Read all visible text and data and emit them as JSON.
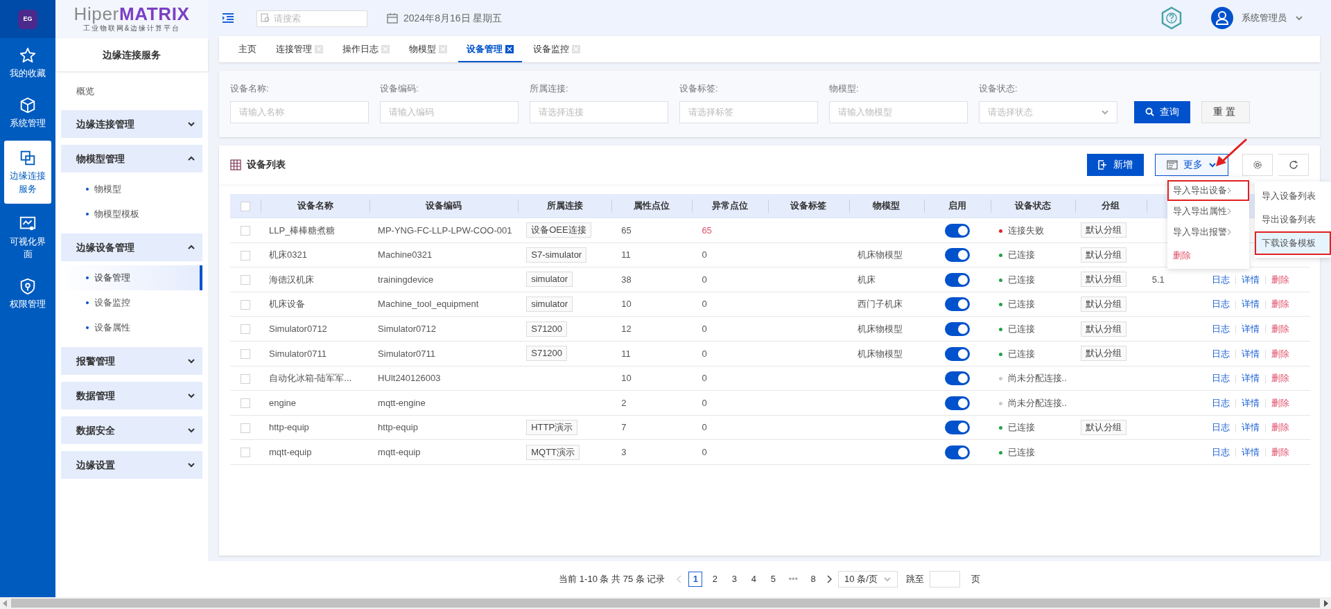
{
  "rail": {
    "app_icon_text": "EG",
    "items": [
      {
        "label": "我的收藏",
        "selected": false
      },
      {
        "label": "系统管理",
        "selected": false
      },
      {
        "label": "边缘连接服务",
        "selected": true
      },
      {
        "label": "可视化界面",
        "selected": false
      },
      {
        "label": "权限管理",
        "selected": false
      }
    ]
  },
  "sidebar": {
    "logo_prefix": "Hiper",
    "logo_suffix": "MATRIX",
    "logo_subtitle": "工业物联网&边缘计算平台",
    "title": "边缘连接服务",
    "items": [
      {
        "kind": "link",
        "label": "概览"
      },
      {
        "kind": "group",
        "label": "边缘连接管理",
        "expanded": false
      },
      {
        "kind": "group",
        "label": "物模型管理",
        "expanded": true,
        "children": [
          {
            "label": "物模型",
            "selected": false
          },
          {
            "label": "物模型模板",
            "selected": false
          }
        ]
      },
      {
        "kind": "group",
        "label": "边缘设备管理",
        "expanded": true,
        "children": [
          {
            "label": "设备管理",
            "selected": true
          },
          {
            "label": "设备监控",
            "selected": false
          },
          {
            "label": "设备属性",
            "selected": false
          }
        ]
      },
      {
        "kind": "group",
        "label": "报警管理",
        "expanded": false
      },
      {
        "kind": "group",
        "label": "数据管理",
        "expanded": false
      },
      {
        "kind": "group",
        "label": "数据安全",
        "expanded": false
      },
      {
        "kind": "group",
        "label": "边缘设置",
        "expanded": false
      }
    ]
  },
  "topbar": {
    "search_placeholder": "请搜索",
    "date": "2024年8月16日 星期五",
    "user": "系统管理员"
  },
  "tabs": [
    {
      "label": "主页",
      "closable": false,
      "selected": false
    },
    {
      "label": "连接管理",
      "closable": true,
      "selected": false
    },
    {
      "label": "操作日志",
      "closable": true,
      "selected": false
    },
    {
      "label": "物模型",
      "closable": true,
      "selected": false
    },
    {
      "label": "设备管理",
      "closable": true,
      "selected": true
    },
    {
      "label": "设备监控",
      "closable": true,
      "selected": false
    }
  ],
  "filters": [
    {
      "kind": "input",
      "label": "设备名称:",
      "placeholder": "请输入名称"
    },
    {
      "kind": "input",
      "label": "设备编码:",
      "placeholder": "请输入编码"
    },
    {
      "kind": "input",
      "label": "所属连接:",
      "placeholder": "请选择连接"
    },
    {
      "kind": "input",
      "label": "设备标签:",
      "placeholder": "请选择标签"
    },
    {
      "kind": "input",
      "label": "物模型:",
      "placeholder": "请输入物模型"
    },
    {
      "kind": "select",
      "label": "设备状态:",
      "placeholder": "请选择状态"
    }
  ],
  "filter_buttons": [
    {
      "kind": "primary",
      "label": "查询"
    },
    {
      "kind": "default",
      "label": "重置"
    }
  ],
  "table": {
    "title": "设备列表",
    "toolbar": {
      "add": "新增",
      "more": "更多"
    },
    "select_all_checked": false,
    "columns": [
      "设备名称",
      "设备编码",
      "所属连接",
      "属性点位",
      "异常点位",
      "设备标签",
      "物模型",
      "启用",
      "设备状态",
      "分组"
    ],
    "rows": [
      {
        "checked": false,
        "name": "LLP_棒棒糖煮糖",
        "code": "MP-YNG-FC-LLP-LPW-COO-001",
        "connection": "设备OEE连接",
        "attrs": "65",
        "abnormal": "65",
        "model": "",
        "on": true,
        "status": "连接失败",
        "color": "#e02020",
        "group": "默认分组"
      },
      {
        "checked": false,
        "name": "机床0321",
        "code": "Machine0321",
        "connection": "S7-simulator",
        "attrs": "11",
        "abnormal": "0",
        "model": "机床物模型",
        "on": true,
        "status": "已连接",
        "color": "#22a045",
        "group": "默认分组"
      },
      {
        "checked": false,
        "name": "海德汉机床",
        "code": "trainingdevice",
        "connection": "simulator",
        "attrs": "38",
        "abnormal": "0",
        "model": "机床",
        "on": true,
        "status": "已连接",
        "color": "#22a045",
        "group": "默认分组",
        "remark": "5.1",
        "ops": [
          "日志",
          "详情",
          "删除"
        ]
      },
      {
        "checked": false,
        "name": "机床设备",
        "code": "Machine_tool_equipment",
        "connection": "simulator",
        "attrs": "10",
        "abnormal": "0",
        "model": "西门子机床",
        "on": true,
        "status": "已连接",
        "color": "#22a045",
        "group": "默认分组",
        "ops": [
          "日志",
          "详情",
          "删除"
        ]
      },
      {
        "checked": false,
        "name": "Simulator0712",
        "code": "Simulator0712",
        "connection": "S71200",
        "attrs": "12",
        "abnormal": "0",
        "model": "机床物模型",
        "on": true,
        "status": "已连接",
        "color": "#22a045",
        "group": "默认分组",
        "ops": [
          "日志",
          "详情",
          "删除"
        ]
      },
      {
        "checked": false,
        "name": "Simulator0711",
        "code": "Simulator0711",
        "connection": "S71200",
        "attrs": "11",
        "abnormal": "0",
        "model": "机床物模型",
        "on": true,
        "status": "已连接",
        "color": "#22a045",
        "group": "默认分组",
        "ops": [
          "日志",
          "详情",
          "删除"
        ]
      },
      {
        "checked": false,
        "name": "自动化冰箱-陆军军...",
        "code": "HUlt240126003",
        "connection": "",
        "attrs": "10",
        "abnormal": "0",
        "model": "",
        "on": true,
        "status": "尚未分配连接..",
        "color": "#c8c8c8",
        "group": "",
        "ops": [
          "日志",
          "详情",
          "删除"
        ]
      },
      {
        "checked": false,
        "name": "engine",
        "code": "mqtt-engine",
        "connection": "",
        "attrs": "2",
        "abnormal": "0",
        "model": "",
        "on": true,
        "status": "尚未分配连接..",
        "color": "#c8c8c8",
        "group": "",
        "ops": [
          "日志",
          "详情",
          "删除"
        ]
      },
      {
        "checked": false,
        "name": "http-equip",
        "code": "http-equip",
        "connection": "HTTP演示",
        "attrs": "7",
        "abnormal": "0",
        "model": "",
        "on": true,
        "status": "已连接",
        "color": "#22a045",
        "group": "默认分组",
        "ops": [
          "日志",
          "详情",
          "删除"
        ]
      },
      {
        "checked": false,
        "name": "mqtt-equip",
        "code": "mqtt-equip",
        "connection": "MQTT演示",
        "attrs": "3",
        "abnormal": "0",
        "model": "",
        "on": true,
        "status": "已连接",
        "color": "#22a045",
        "group": "",
        "ops": [
          "日志",
          "详情",
          "删除"
        ]
      }
    ]
  },
  "more_menu": {
    "items": [
      {
        "kind": "submenu",
        "label": "导入导出设备",
        "highlighted": true
      },
      {
        "kind": "submenu",
        "label": "导入导出属性",
        "highlighted": false
      },
      {
        "kind": "submenu",
        "label": "导入导出报警",
        "highlighted": false
      },
      {
        "kind": "danger",
        "label": "删除",
        "highlighted": false
      }
    ],
    "submenu": [
      {
        "label": "导入设备列表",
        "highlighted": false
      },
      {
        "label": "导出设备列表",
        "highlighted": false
      },
      {
        "label": "下载设备模板",
        "highlighted": true
      }
    ]
  },
  "pagination": {
    "summary": "当前 1-10 条 共 75 条 记录",
    "pages": [
      {
        "label": "1",
        "selected": true
      },
      {
        "label": "2",
        "selected": false
      },
      {
        "label": "3",
        "selected": false
      },
      {
        "label": "4",
        "selected": false
      },
      {
        "label": "5",
        "selected": false
      },
      {
        "label": "•••",
        "selected": false
      },
      {
        "label": "8",
        "selected": false
      }
    ],
    "page_size": "10 条/页",
    "jump_label": "跳至",
    "page_unit": "页"
  }
}
